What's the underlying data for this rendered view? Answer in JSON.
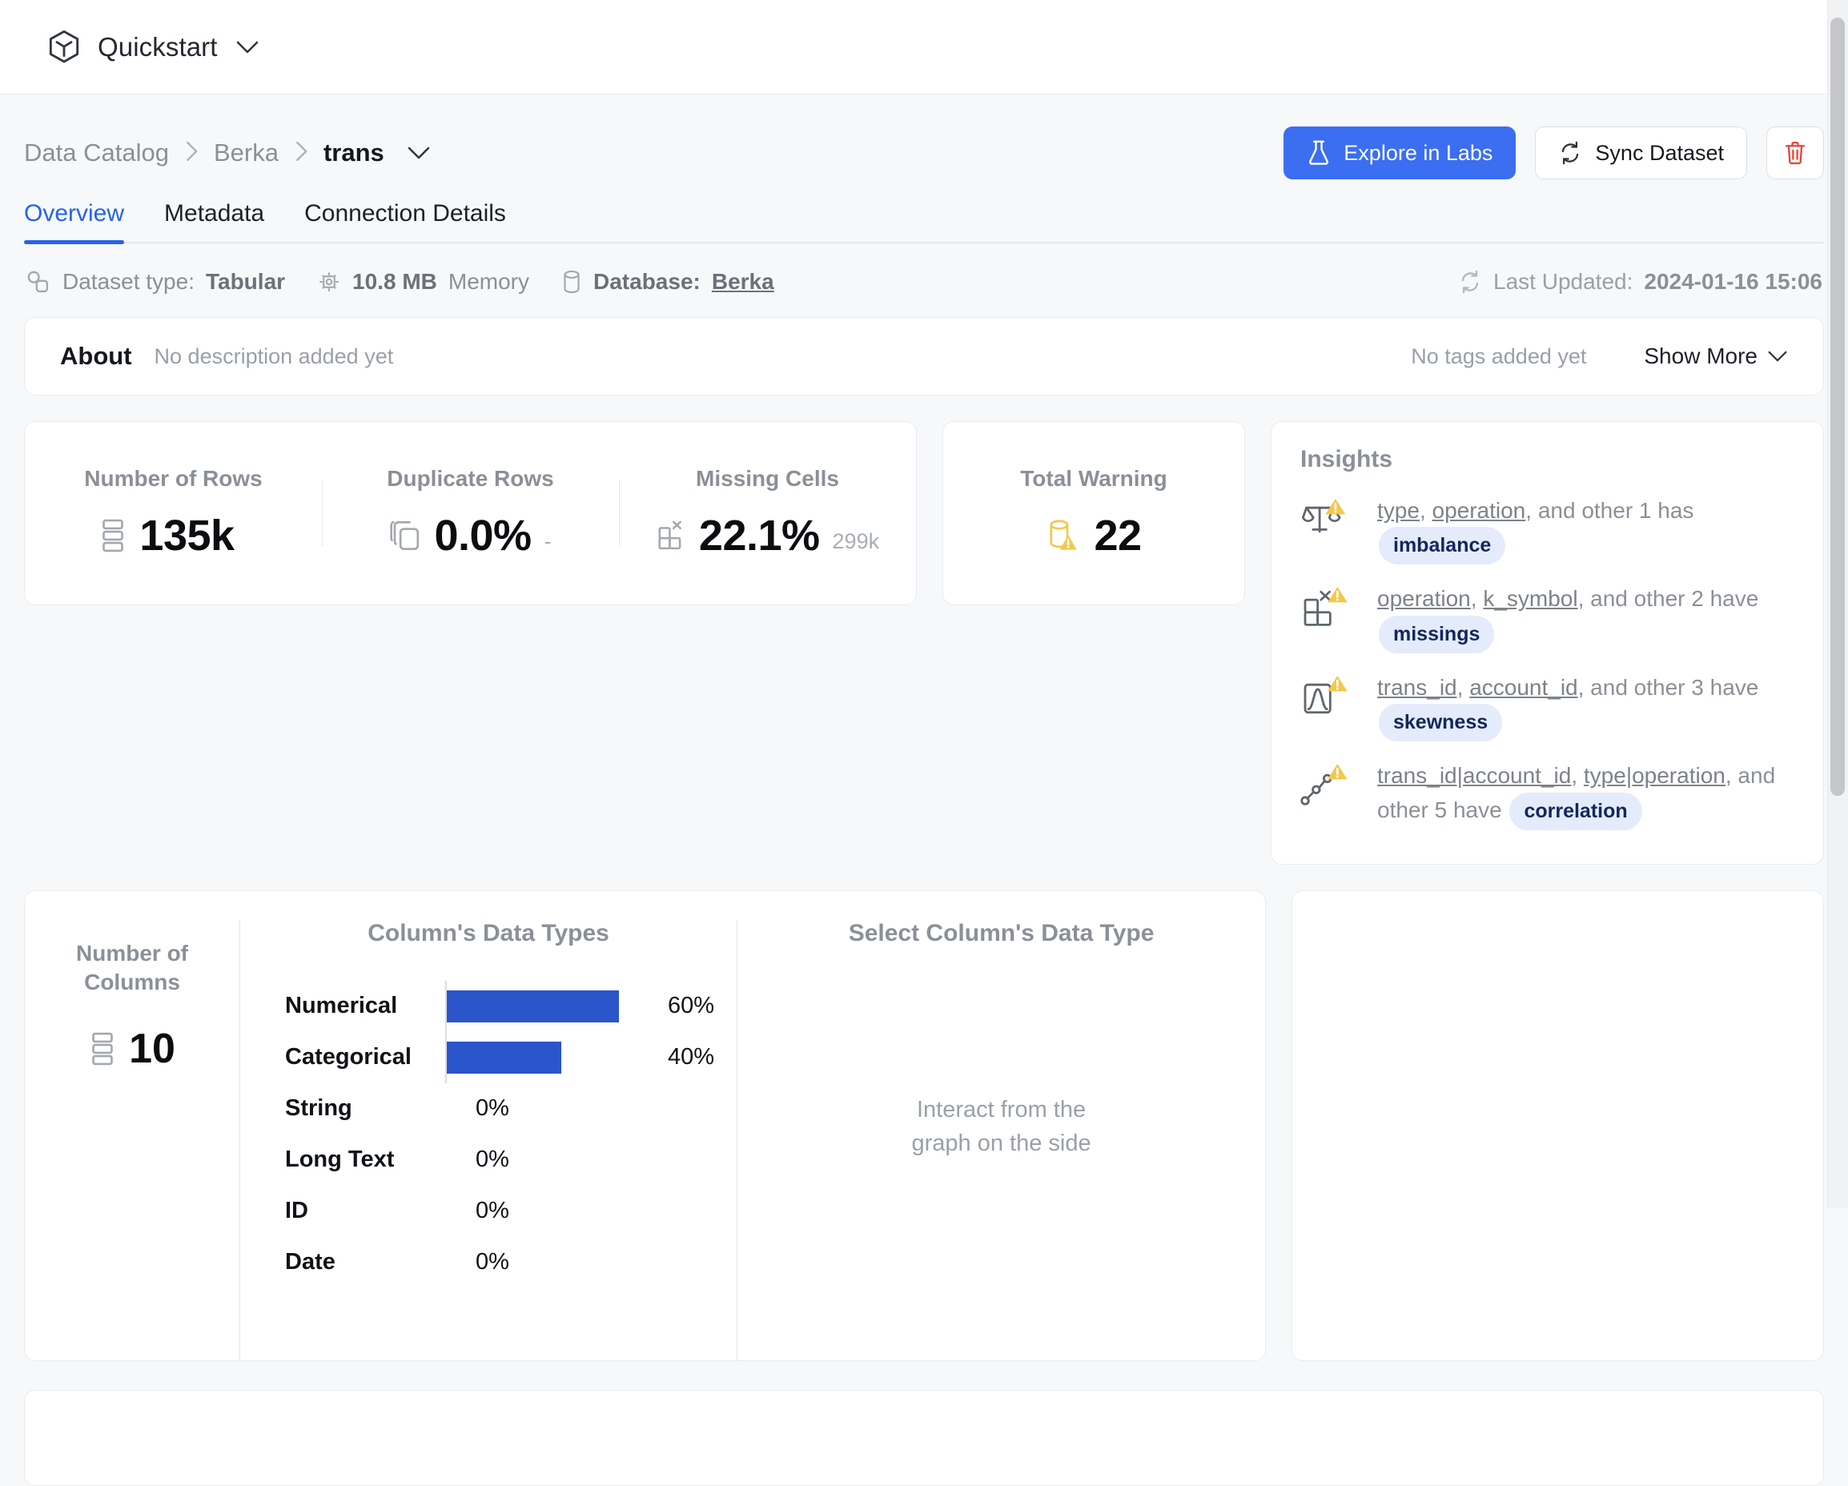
{
  "topbar": {
    "brand": "Quickstart",
    "brand_icon": "cube-icon",
    "chevron_icon": "chevron-down-icon"
  },
  "breadcrumb": {
    "items": [
      "Data Catalog",
      "Berka",
      "trans"
    ],
    "separator": "›",
    "chevron_icon": "chevron-down-icon"
  },
  "header_actions": {
    "explore_label": "Explore in Labs",
    "explore_icon": "flask-icon",
    "sync_label": "Sync Dataset",
    "sync_icon": "sync-icon",
    "delete_icon": "trash-icon",
    "primary_color": "#3b6ef0",
    "danger_color": "#e8453c"
  },
  "tabs": [
    {
      "label": "Overview",
      "active": true
    },
    {
      "label": "Metadata",
      "active": false
    },
    {
      "label": "Connection Details",
      "active": false
    }
  ],
  "meta": {
    "dataset_type_label": "Dataset type:",
    "dataset_type_value": "Tabular",
    "memory_value": "10.8 MB",
    "memory_label": "Memory",
    "database_label": "Database:",
    "database_value": "Berka",
    "last_updated_label": "Last Updated:",
    "last_updated_value": "2024-01-16 15:06"
  },
  "about": {
    "title": "About",
    "description": "No description added yet",
    "tags": "No tags added yet",
    "show_more": "Show More"
  },
  "stats": [
    {
      "label": "Number of Rows",
      "icon": "rows-icon",
      "value": "135k",
      "sub": ""
    },
    {
      "label": "Duplicate Rows",
      "icon": "duplicate-icon",
      "value": "0.0%",
      "sub": "-"
    },
    {
      "label": "Missing Cells",
      "icon": "missing-icon",
      "value": "22.1%",
      "sub": "299k"
    }
  ],
  "warning": {
    "label": "Total Warning",
    "value": "22",
    "icon": "database-warning-icon",
    "color": "#f2c94c"
  },
  "insights": {
    "title": "Insights",
    "items": [
      {
        "icon": "scale-icon",
        "columns": [
          "type",
          "operation"
        ],
        "mid": ", and other 1  has ",
        "badge": "imbalance"
      },
      {
        "icon": "missing-icon",
        "columns": [
          "operation",
          "k_symbol"
        ],
        "mid": ", and other 2  have ",
        "badge": "missings"
      },
      {
        "icon": "distribution-icon",
        "columns": [
          "trans_id",
          "account_id"
        ],
        "mid": ", and other 3  have ",
        "badge": "skewness"
      },
      {
        "icon": "correlation-icon",
        "columns": [
          "trans_id|account_id",
          "type|operation"
        ],
        "mid": ", and other 5  have ",
        "badge": "correlation"
      }
    ],
    "badge_bg": "#e4ebfb",
    "badge_fg": "#12275c"
  },
  "columns_panel": {
    "numcols_label": "Number of\nColumns",
    "numcols_value": "10",
    "numcols_icon": "rows-icon",
    "select_heading": "Select Column's Data Type",
    "select_empty": "Interact from the\ngraph on the side"
  },
  "chart_data": {
    "type": "bar",
    "title": "Column's Data Types",
    "orientation": "horizontal",
    "categories": [
      "Numerical",
      "Categorical",
      "String",
      "Long Text",
      "ID",
      "Date"
    ],
    "values": [
      60,
      40,
      0,
      0,
      0,
      0
    ],
    "labels": [
      "60%",
      "40%",
      "0%",
      "0%",
      "0%",
      "0%"
    ],
    "xlabel": "",
    "ylabel": "",
    "xlim": [
      0,
      100
    ],
    "grid": false,
    "legend": null,
    "bar_color": "#2a55cb"
  }
}
